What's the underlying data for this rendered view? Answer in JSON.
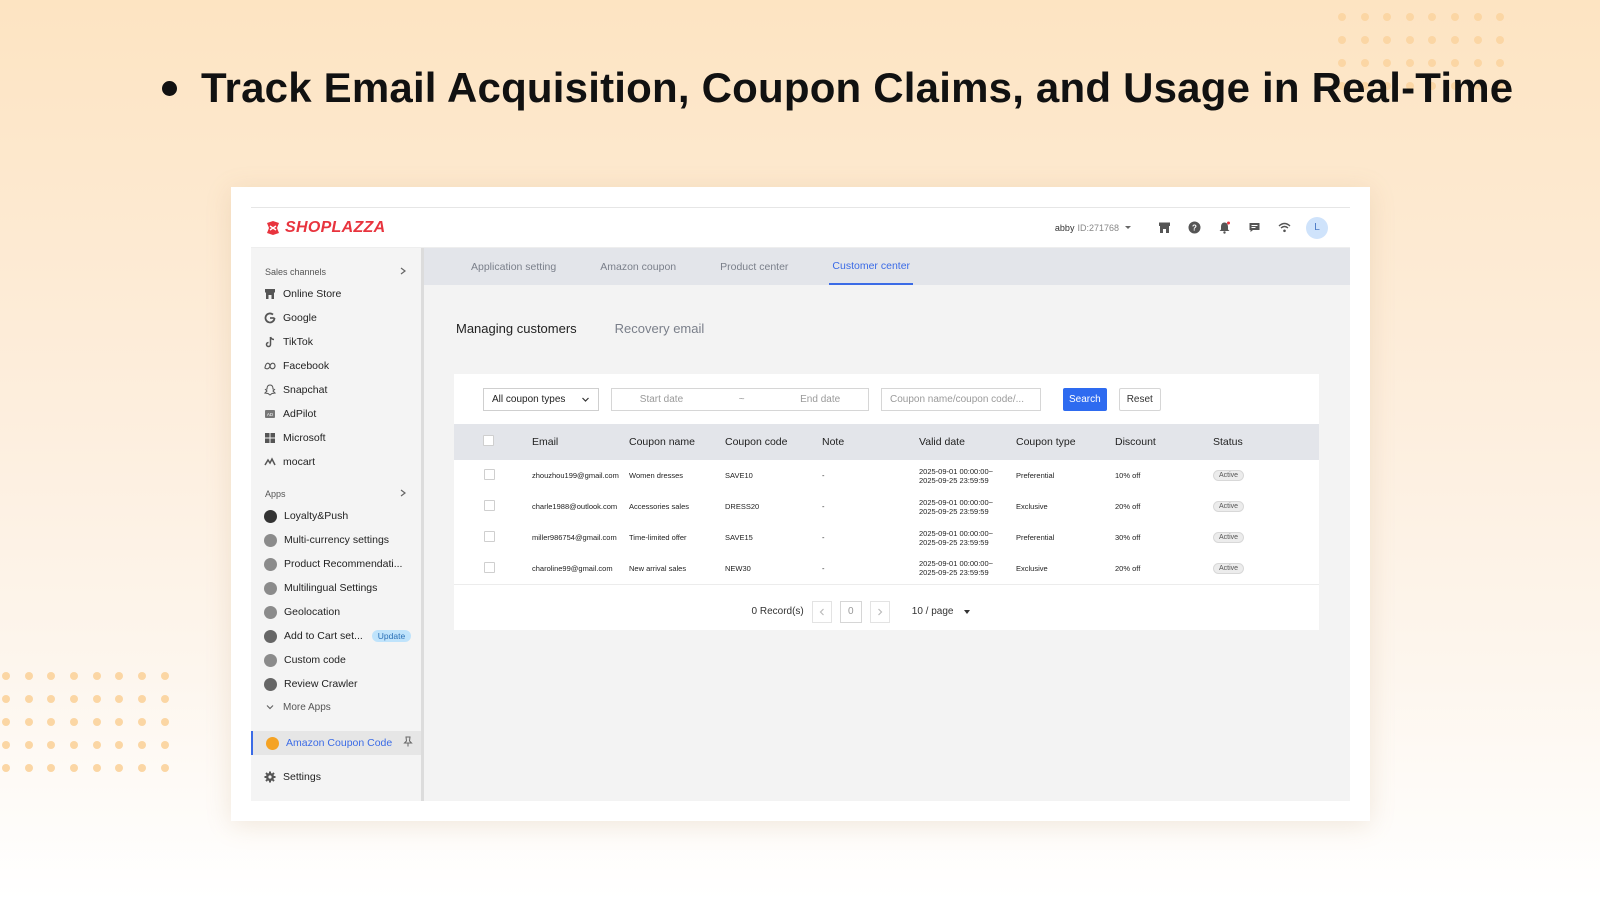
{
  "headline": "Track Email Acquisition, Coupon Claims, and Usage in Real-Time",
  "topbar": {
    "brand": "SHOPLAZZA",
    "account_name": "abby",
    "account_id": "ID:271768",
    "avatar_letter": "L"
  },
  "sidebar": {
    "sales_channels_label": "Sales channels",
    "channels": [
      {
        "label": "Online Store",
        "icon": "store-icon"
      },
      {
        "label": "Google",
        "icon": "google-icon"
      },
      {
        "label": "TikTok",
        "icon": "tiktok-icon"
      },
      {
        "label": "Facebook",
        "icon": "meta-icon"
      },
      {
        "label": "Snapchat",
        "icon": "snapchat-icon"
      },
      {
        "label": "AdPilot",
        "icon": "adpilot-icon"
      },
      {
        "label": "Microsoft",
        "icon": "microsoft-icon"
      },
      {
        "label": "mocart",
        "icon": "mocart-icon"
      }
    ],
    "apps_label": "Apps",
    "apps": [
      {
        "label": "Loyalty&Push"
      },
      {
        "label": "Multi-currency settings"
      },
      {
        "label": "Product Recommendati..."
      },
      {
        "label": "Multilingual Settings"
      },
      {
        "label": "Geolocation"
      },
      {
        "label": "Add to Cart set...",
        "badge": "Update"
      },
      {
        "label": "Custom code"
      },
      {
        "label": "Review Crawler"
      }
    ],
    "more_apps": "More Apps",
    "pinned_app": "Amazon Coupon Code",
    "settings": "Settings"
  },
  "tabs": [
    "Application setting",
    "Amazon coupon",
    "Product center",
    "Customer center"
  ],
  "active_tab": "Customer center",
  "subtabs": [
    "Managing customers",
    "Recovery email"
  ],
  "filters": {
    "coupon_type": "All coupon types",
    "start_date_placeholder": "Start date",
    "date_separator": "~",
    "end_date_placeholder": "End date",
    "search_placeholder": "Coupon name/coupon code/...",
    "search_button": "Search",
    "reset_button": "Reset"
  },
  "table": {
    "columns": [
      "Email",
      "Coupon name",
      "Coupon code",
      "Note",
      "Valid date",
      "Coupon type",
      "Discount",
      "Status"
    ],
    "rows": [
      {
        "email": "zhouzhou199@gmail.com",
        "coupon_name": "Women dresses",
        "coupon_code": "SAVE10",
        "note": "-",
        "valid_from": "2025-09-01 00:00:00~",
        "valid_to": "2025-09-25 23:59:59",
        "coupon_type": "Preferential",
        "discount": "10% off",
        "status": "Active"
      },
      {
        "email": "charle1988@outlook.com",
        "coupon_name": "Accessories sales",
        "coupon_code": "DRESS20",
        "note": "-",
        "valid_from": "2025-09-01 00:00:00~",
        "valid_to": "2025-09-25 23:59:59",
        "coupon_type": "Exclusive",
        "discount": "20% off",
        "status": "Active"
      },
      {
        "email": "miller986754@gmail.com",
        "coupon_name": "Time-limited offer",
        "coupon_code": "SAVE15",
        "note": "-",
        "valid_from": "2025-09-01 00:00:00~",
        "valid_to": "2025-09-25 23:59:59",
        "coupon_type": "Preferential",
        "discount": "30% off",
        "status": "Active"
      },
      {
        "email": "charoline99@gmail.com",
        "coupon_name": "New arrival sales",
        "coupon_code": "NEW30",
        "note": "-",
        "valid_from": "2025-09-01 00:00:00~",
        "valid_to": "2025-09-25 23:59:59",
        "coupon_type": "Exclusive",
        "discount": "20% off",
        "status": "Active"
      }
    ]
  },
  "pagination": {
    "records": "0 Record(s)",
    "current_page": "0",
    "per_page": "10 / page"
  },
  "colors": {
    "accent": "#2e6bf0",
    "brand": "#e8343e",
    "background_top": "#fde4c2",
    "dots": "#fbd6a4"
  }
}
